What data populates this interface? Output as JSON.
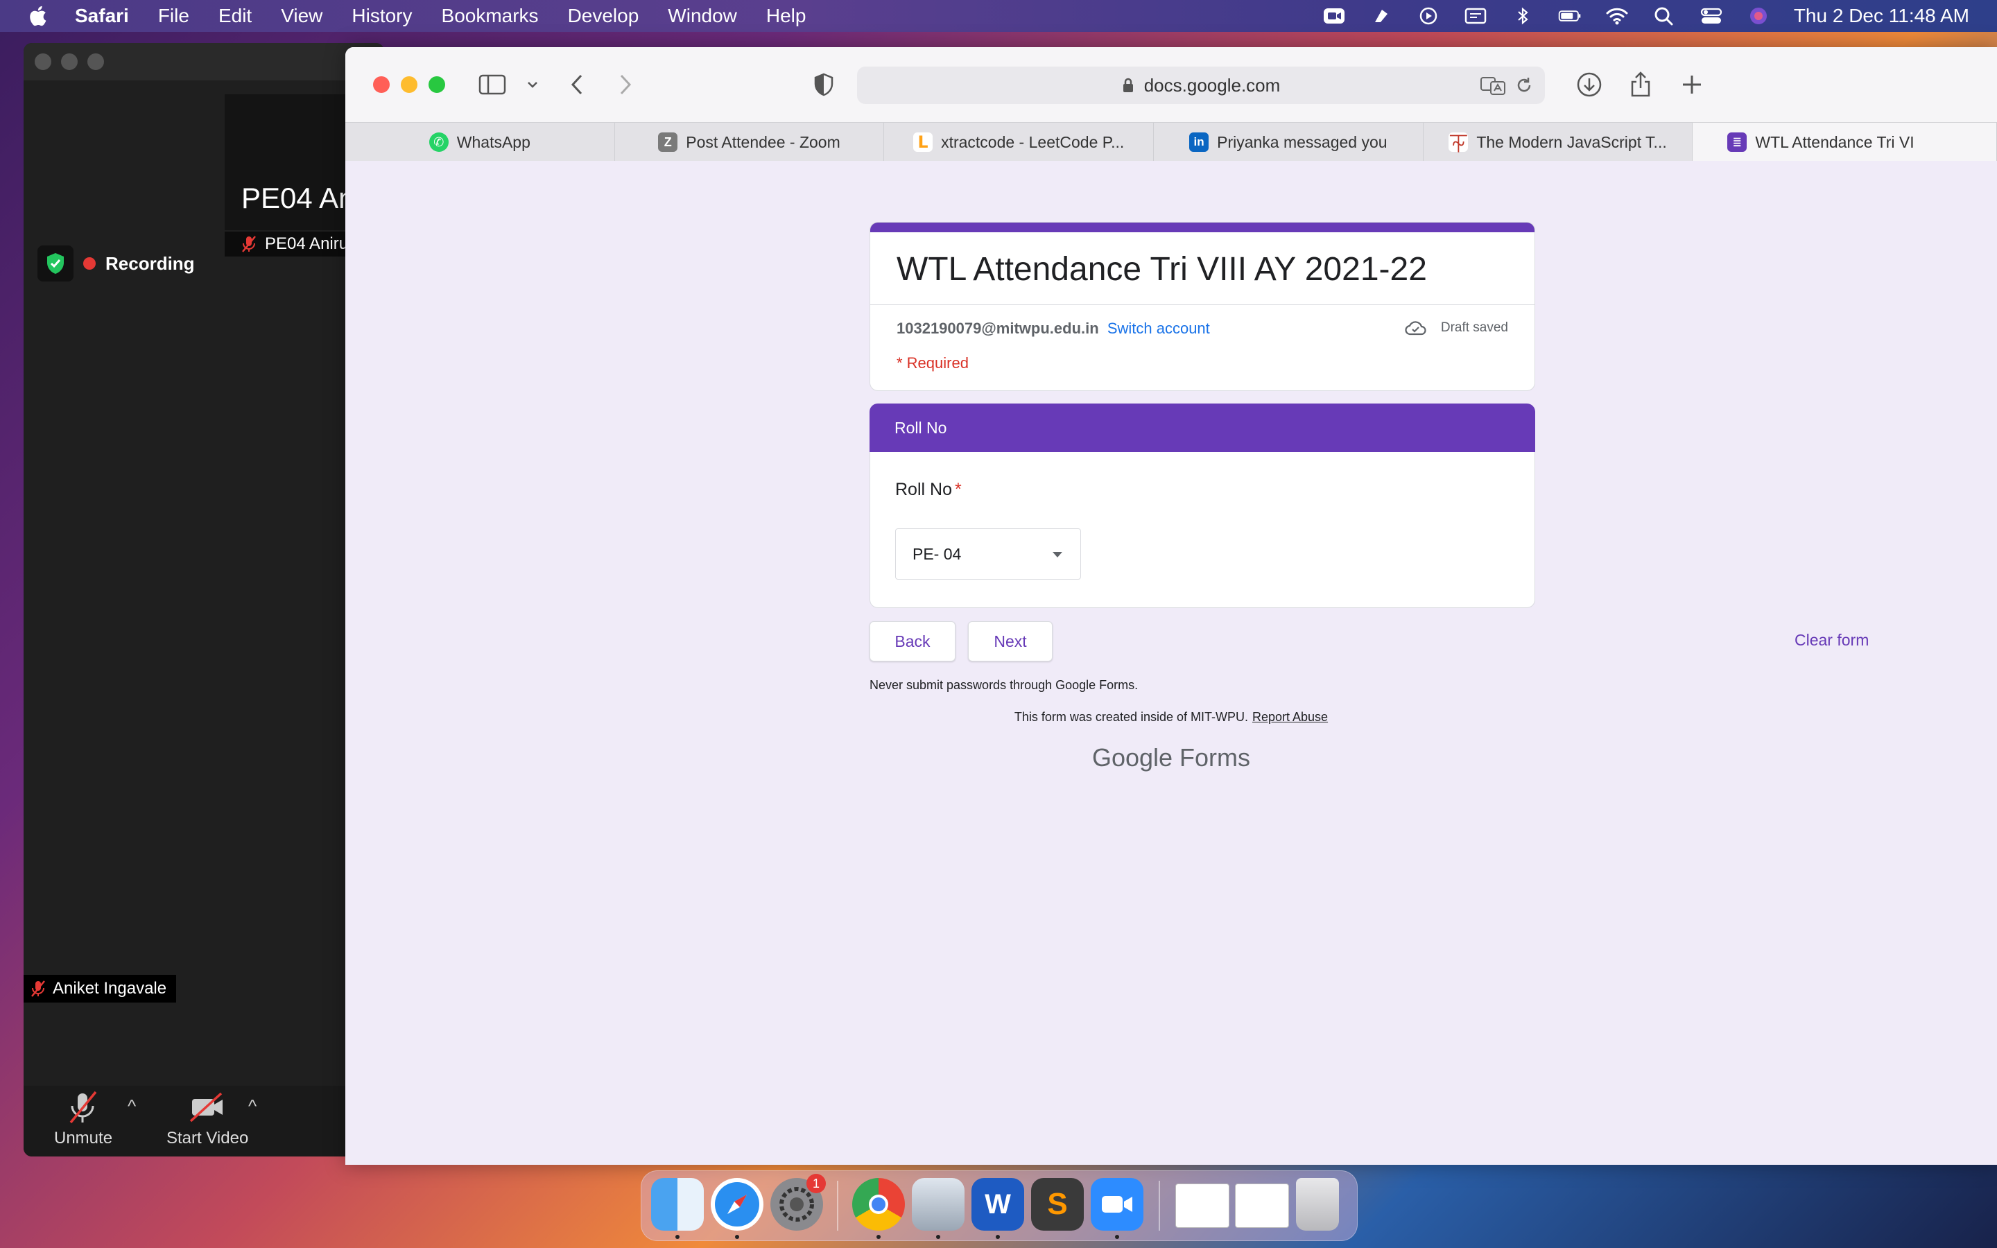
{
  "menubar": {
    "app_name": "Safari",
    "items": [
      "File",
      "Edit",
      "View",
      "History",
      "Bookmarks",
      "Develop",
      "Window",
      "Help"
    ],
    "clock": "Thu 2 Dec  11:48 AM"
  },
  "zoom": {
    "speaker_name": "PE04 An",
    "speaker_tag": "PE04 Aniru",
    "recording_label": "Recording",
    "self_name": "Aniket Ingavale",
    "unmute_label": "Unmute",
    "start_video_label": "Start Video"
  },
  "safari": {
    "url": "docs.google.com",
    "tabs": [
      {
        "label": "WhatsApp",
        "icon": "whatsapp-icon",
        "color": "#25d366"
      },
      {
        "label": "Post Attendee - Zoom",
        "icon": "zoom-z-icon",
        "color": "#7a7a7a"
      },
      {
        "label": "xtractcode - LeetCode P...",
        "icon": "leetcode-icon",
        "color": "#ffa116"
      },
      {
        "label": "Priyanka messaged you",
        "icon": "linkedin-icon",
        "color": "#0a66c2"
      },
      {
        "label": "The Modern JavaScript T...",
        "icon": "js-tutorial-icon",
        "color": "#c0392b"
      },
      {
        "label": "WTL Attendance Tri VI",
        "icon": "google-forms-icon",
        "color": "#673ab7"
      }
    ]
  },
  "form": {
    "title": "WTL Attendance Tri VIII AY 2021-22",
    "email": "1032190079@mitwpu.edu.in",
    "switch_account": "Switch account",
    "draft_status": "Draft saved",
    "required_note": "* Required",
    "section_title": "Roll No",
    "question_label": "Roll No",
    "question_required_mark": "*",
    "selected_value": "PE- 04",
    "back_label": "Back",
    "next_label": "Next",
    "clear_label": "Clear form",
    "password_notice": "Never submit passwords through Google Forms.",
    "created_text": "This form was created inside of MIT-WPU.",
    "report_abuse": "Report Abuse",
    "brand_google": "Google",
    "brand_forms": "Forms",
    "accent_color": "#673ab7"
  },
  "dock": {
    "apps": [
      "finder",
      "safari",
      "system-preferences",
      "chrome",
      "preview",
      "word",
      "sublime-text",
      "zoom",
      "documents",
      "documents",
      "trash"
    ],
    "system_preferences_badge": "1"
  }
}
